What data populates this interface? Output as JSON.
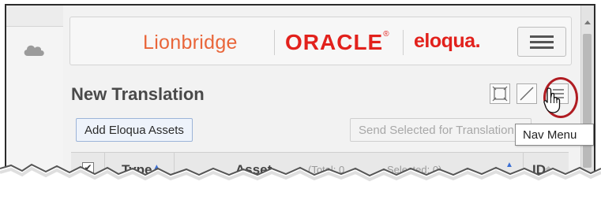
{
  "brand": {
    "lionbridge": "Lionbridge",
    "oracle": "ORACLE",
    "oracle_mark": "®",
    "eloqua": "eloqua.",
    "colors": {
      "lionbridge": "#e9663a",
      "oracle": "#e2211c"
    }
  },
  "page": {
    "title": "New Translation"
  },
  "toolbar": {
    "add_assets_label": "Add Eloqua Assets",
    "send_selected_label": "Send Selected for Translation"
  },
  "grid": {
    "columns": {
      "type": "Type",
      "asset": "Asset",
      "total": "(Total: 0",
      "selected": "Selected: 0)",
      "id": "ID"
    },
    "select_all_checked": true
  },
  "tooltip": {
    "text": "Nav Menu"
  },
  "icons": [
    "cloud-icon",
    "hamburger-icon",
    "fit-view-icon",
    "expand-icon",
    "nav-menu-icon",
    "hand-cursor-icon",
    "sort-asc-icon"
  ],
  "accent": {
    "highlight_ring": "#b01c22",
    "sort_arrow": "#3b6fd4"
  }
}
